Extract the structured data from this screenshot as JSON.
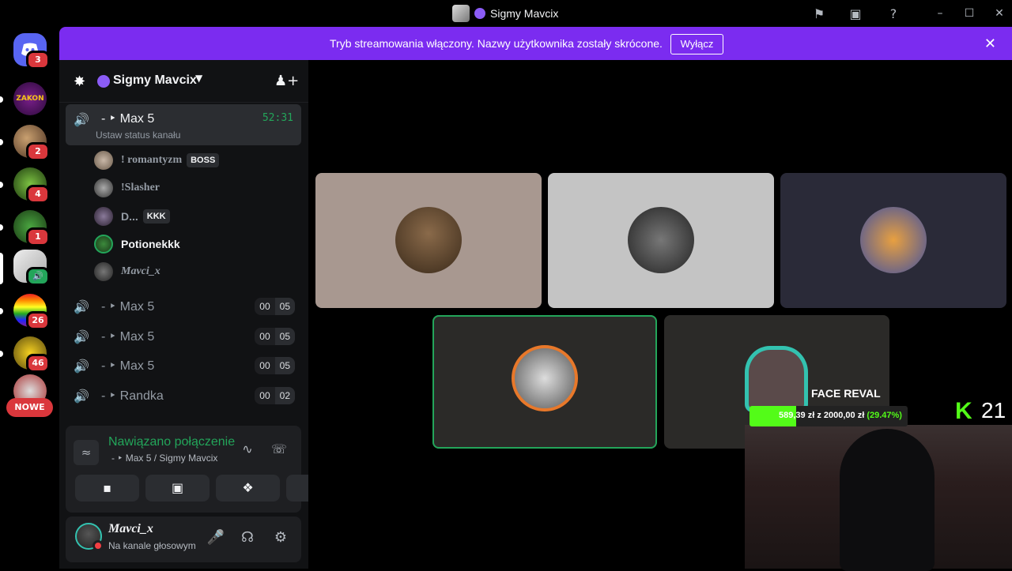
{
  "window": {
    "title": "Sigmy Mavcix",
    "icons": [
      "flag-icon",
      "inbox-icon",
      "help-icon"
    ],
    "controls": [
      "minimize",
      "maximize",
      "close"
    ]
  },
  "banner": {
    "text": "Tryb streamowania włączony. Nazwy użytkownika zostały skrócone.",
    "button": "Wyłącz"
  },
  "rail": {
    "home_badge": "3",
    "guilds": [
      {
        "label": "ZAKON",
        "badge": ""
      },
      {
        "label": "",
        "badge": "2"
      },
      {
        "label": "",
        "badge": "4"
      },
      {
        "label": "",
        "badge": "1"
      },
      {
        "label": "",
        "badge": ""
      },
      {
        "label": "",
        "badge": "26"
      },
      {
        "label": "",
        "badge": "46"
      },
      {
        "label": "",
        "badge": ""
      }
    ],
    "new_label": "NOWE"
  },
  "server": {
    "name": "Sigmy Mavcix"
  },
  "channels": {
    "active": {
      "name": "- ‣ Max 5",
      "timer": "52:31",
      "status_hint": "Ustaw status kanału"
    },
    "members": [
      {
        "name": "! romantyzm",
        "tag": "BOSS"
      },
      {
        "name": "!Slasher",
        "tag": ""
      },
      {
        "name": "D...",
        "tag": "KKK"
      },
      {
        "name": "Potionekkk",
        "tag": ""
      },
      {
        "name": "Mavci_x",
        "tag": ""
      }
    ],
    "others": [
      {
        "name": "- ‣ Max 5",
        "count": "00",
        "limit": "05"
      },
      {
        "name": "- ‣ Max 5",
        "count": "00",
        "limit": "05"
      },
      {
        "name": "- ‣ Max 5",
        "count": "00",
        "limit": "05"
      },
      {
        "name": "- ‣ Randka",
        "count": "00",
        "limit": "02"
      }
    ]
  },
  "connection": {
    "title": "Nawiązano połączenie",
    "subtitle": "- ‣ Max 5 / Sigmy Mavcix"
  },
  "user": {
    "name": "Mavci_x",
    "status": "Na kanale głosowym"
  },
  "overlay": {
    "title": "FACE REVAL",
    "progress_text": "589,39 zł",
    "progress_sep": "z",
    "goal_text": "2000,00 zł",
    "percent_text": "(29.47%)",
    "progress": 0.2947,
    "brand_letter": "K",
    "viewers": "21"
  },
  "colors": {
    "accent": "#7b2cf0",
    "green": "#23a55a",
    "kick": "#53fc18",
    "danger": "#da373c"
  }
}
